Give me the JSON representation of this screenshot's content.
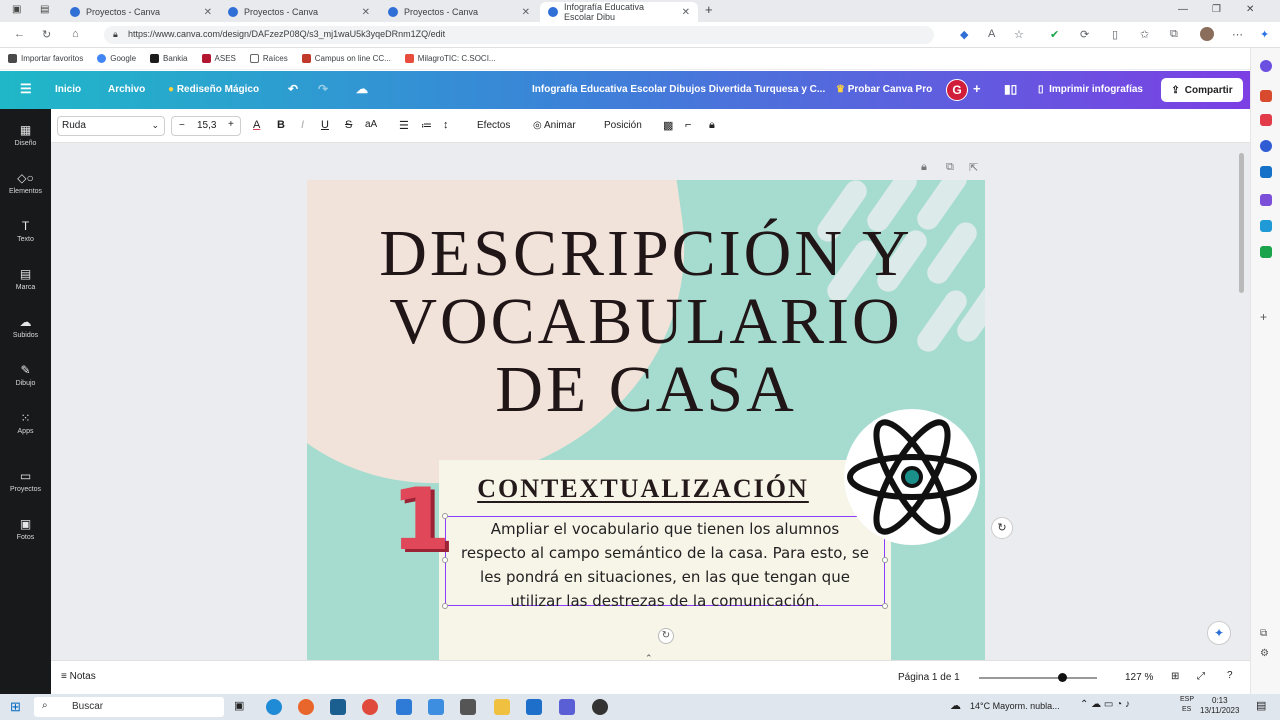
{
  "browser": {
    "tabs": [
      {
        "label": "Proyectos - Canva",
        "active": false
      },
      {
        "label": "Proyectos - Canva",
        "active": false
      },
      {
        "label": "Proyectos - Canva",
        "active": false
      },
      {
        "label": "Infografía Educativa Escolar Dibu",
        "active": true
      }
    ],
    "url": "https://www.canva.com/design/DAFzezP08Q/s3_mj1waU5k3yqeDRnm1ZQ/edit",
    "bookmarks": [
      "Importar favoritos",
      "Google",
      "Bankia",
      "ASES",
      "Raíces",
      "Campus on line CC...",
      "MilagroTIC: C.SOCI..."
    ]
  },
  "canva_header": {
    "home": "Inicio",
    "file": "Archivo",
    "magic": "Rediseño Mágico",
    "doc_title": "Infografía Educativa Escolar Dibujos Divertida Turquesa y C...",
    "try_pro": "Probar Canva Pro",
    "avatar_initial": "G",
    "print": "Imprimir infografías",
    "share": "Compartir"
  },
  "sidebar": {
    "items": [
      {
        "label": "Diseño",
        "icon": "layout-icon"
      },
      {
        "label": "Elementos",
        "icon": "elements-icon"
      },
      {
        "label": "Texto",
        "icon": "text-icon"
      },
      {
        "label": "Marca",
        "icon": "brand-icon"
      },
      {
        "label": "Subidos",
        "icon": "upload-icon"
      },
      {
        "label": "Dibujo",
        "icon": "draw-icon"
      },
      {
        "label": "Apps",
        "icon": "apps-icon"
      },
      {
        "label": "Proyectos",
        "icon": "folder-icon"
      },
      {
        "label": "Fotos",
        "icon": "photo-icon"
      }
    ]
  },
  "toolbar": {
    "font": "Ruda",
    "minus": "−",
    "size": "15,3",
    "plus": "+",
    "effects": "Efectos",
    "animate": "Animar",
    "position": "Posición"
  },
  "design": {
    "title_lines": [
      "DESCRIPCIÓN Y",
      "VOCABULARIO",
      "DE CASA"
    ],
    "number": "1",
    "heading": "CONTEXTUALIZACIÓN",
    "body_lines": [
      "Ampliar el vocabulario que tienen los alumnos",
      "respecto al campo semántico de la casa. Para esto, se",
      "les pondrá en situaciones, en las que tengan que",
      "utilizar las destrezas de la comunicación."
    ],
    "colors": {
      "background": "#a6dccf",
      "blob": "#f2e3da",
      "card": "#f7f4e8",
      "number": "#e0485a",
      "selection": "#8b3dff"
    }
  },
  "status": {
    "notes": "Notas",
    "page": "Página 1 de 1",
    "zoom": "127 %",
    "zoom_level": 0.7
  },
  "taskbar": {
    "search": "Buscar",
    "weather": "14°C  Mayorm. nubla...",
    "lang_top": "ESP",
    "lang_bottom": "ES",
    "time": "0:13",
    "date": "13/11/2023"
  }
}
